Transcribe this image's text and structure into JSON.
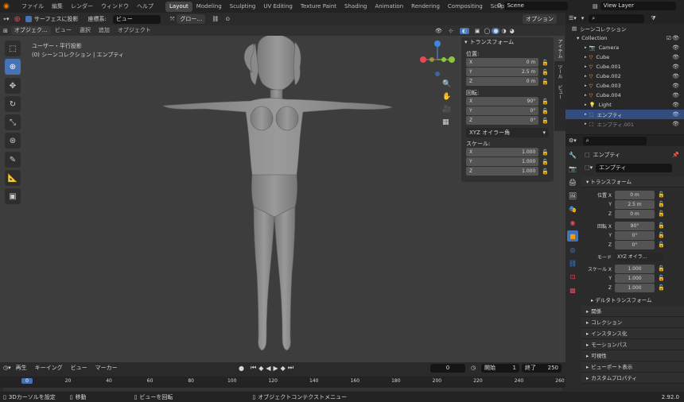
{
  "topbar": {
    "menus": [
      "ファイル",
      "編集",
      "レンダー",
      "ウィンドウ",
      "ヘルプ"
    ],
    "workspaces": [
      "Layout",
      "Modeling",
      "Sculpting",
      "UV Editing",
      "Texture Paint",
      "Shading",
      "Animation",
      "Rendering",
      "Compositing",
      "Scripting"
    ],
    "active_workspace": "Layout",
    "scene": "Scene",
    "view_layer": "View Layer"
  },
  "vp_header": {
    "surface_project": "サーフェスに投影",
    "orientation_label": "座標系:",
    "orientation_value": "ビュー",
    "pivot_value": "グロー…",
    "options": "オプション",
    "mode": "オブジェク…",
    "menus": [
      "ビュー",
      "選択",
      "追加",
      "オブジェクト"
    ]
  },
  "viewport": {
    "view_name": "ユーザー・平行投影",
    "collection_info": "(0) シーンコレクション | エンプティ"
  },
  "npanel": {
    "title": "トランスフォーム",
    "location_label": "位置:",
    "location": [
      {
        "axis": "X",
        "value": "0 m"
      },
      {
        "axis": "Y",
        "value": "2.5 m"
      },
      {
        "axis": "Z",
        "value": "0 m"
      }
    ],
    "rotation_label": "回転:",
    "rotation": [
      {
        "axis": "X",
        "value": "90°"
      },
      {
        "axis": "Y",
        "value": "0°"
      },
      {
        "axis": "Z",
        "value": "0°"
      }
    ],
    "rotation_mode": "XYZ オイラー角",
    "scale_label": "スケール:",
    "scale": [
      {
        "axis": "X",
        "value": "1.000"
      },
      {
        "axis": "Y",
        "value": "1.000"
      },
      {
        "axis": "Z",
        "value": "1.000"
      }
    ],
    "side_tabs": [
      "アイテム",
      "ツール",
      "ビュー"
    ]
  },
  "outliner": {
    "root": "シーンコレクション",
    "collection": "Collection",
    "items": [
      "Camera",
      "Cube",
      "Cube.001",
      "Cube.002",
      "Cube.003",
      "Cube.004",
      "Light",
      "エンプティ",
      "エンプティ.001"
    ],
    "selected": "エンプティ"
  },
  "properties": {
    "object_name": "エンプティ",
    "data_name": "エンプティ",
    "transform_title": "トランスフォーム",
    "location_label": "位置 X",
    "location": [
      "0 m",
      "2.5 m",
      "0 m"
    ],
    "rotation_label": "回転 X",
    "rotation": [
      "90°",
      "0°",
      "0°"
    ],
    "mode_label": "モード",
    "mode_value": "XYZ オイラ…",
    "scale_label": "スケール X",
    "scale": [
      "1.000",
      "1.000",
      "1.000"
    ],
    "axis_y": "Y",
    "axis_z": "Z",
    "delta": "デルタトランスフォーム",
    "sections": [
      "関係",
      "コレクション",
      "インスタンス化",
      "モーションパス",
      "可視性",
      "ビューポート表示",
      "カスタムプロパティ"
    ]
  },
  "timeline": {
    "playback": "再生",
    "keying": "キーイング",
    "view": "ビュー",
    "marker": "マーカー",
    "current_frame": "0",
    "start_label": "開始",
    "start": "1",
    "end_label": "終了",
    "end": "250",
    "ticks": [
      "0",
      "20",
      "40",
      "60",
      "80",
      "100",
      "120",
      "140",
      "160",
      "180",
      "200",
      "220",
      "240",
      "260"
    ]
  },
  "statusbar": {
    "hint1": "3Dカーソルを設定",
    "hint2": "移動",
    "hint3": "ビューを回転",
    "hint4": "オブジェクトコンテクストメニュー",
    "version": "2.92.0"
  },
  "colors": {
    "accent": "#4772b3",
    "x_axis": "#e54856",
    "y_axis": "#8bc53f",
    "z_axis": "#3e86e0"
  }
}
